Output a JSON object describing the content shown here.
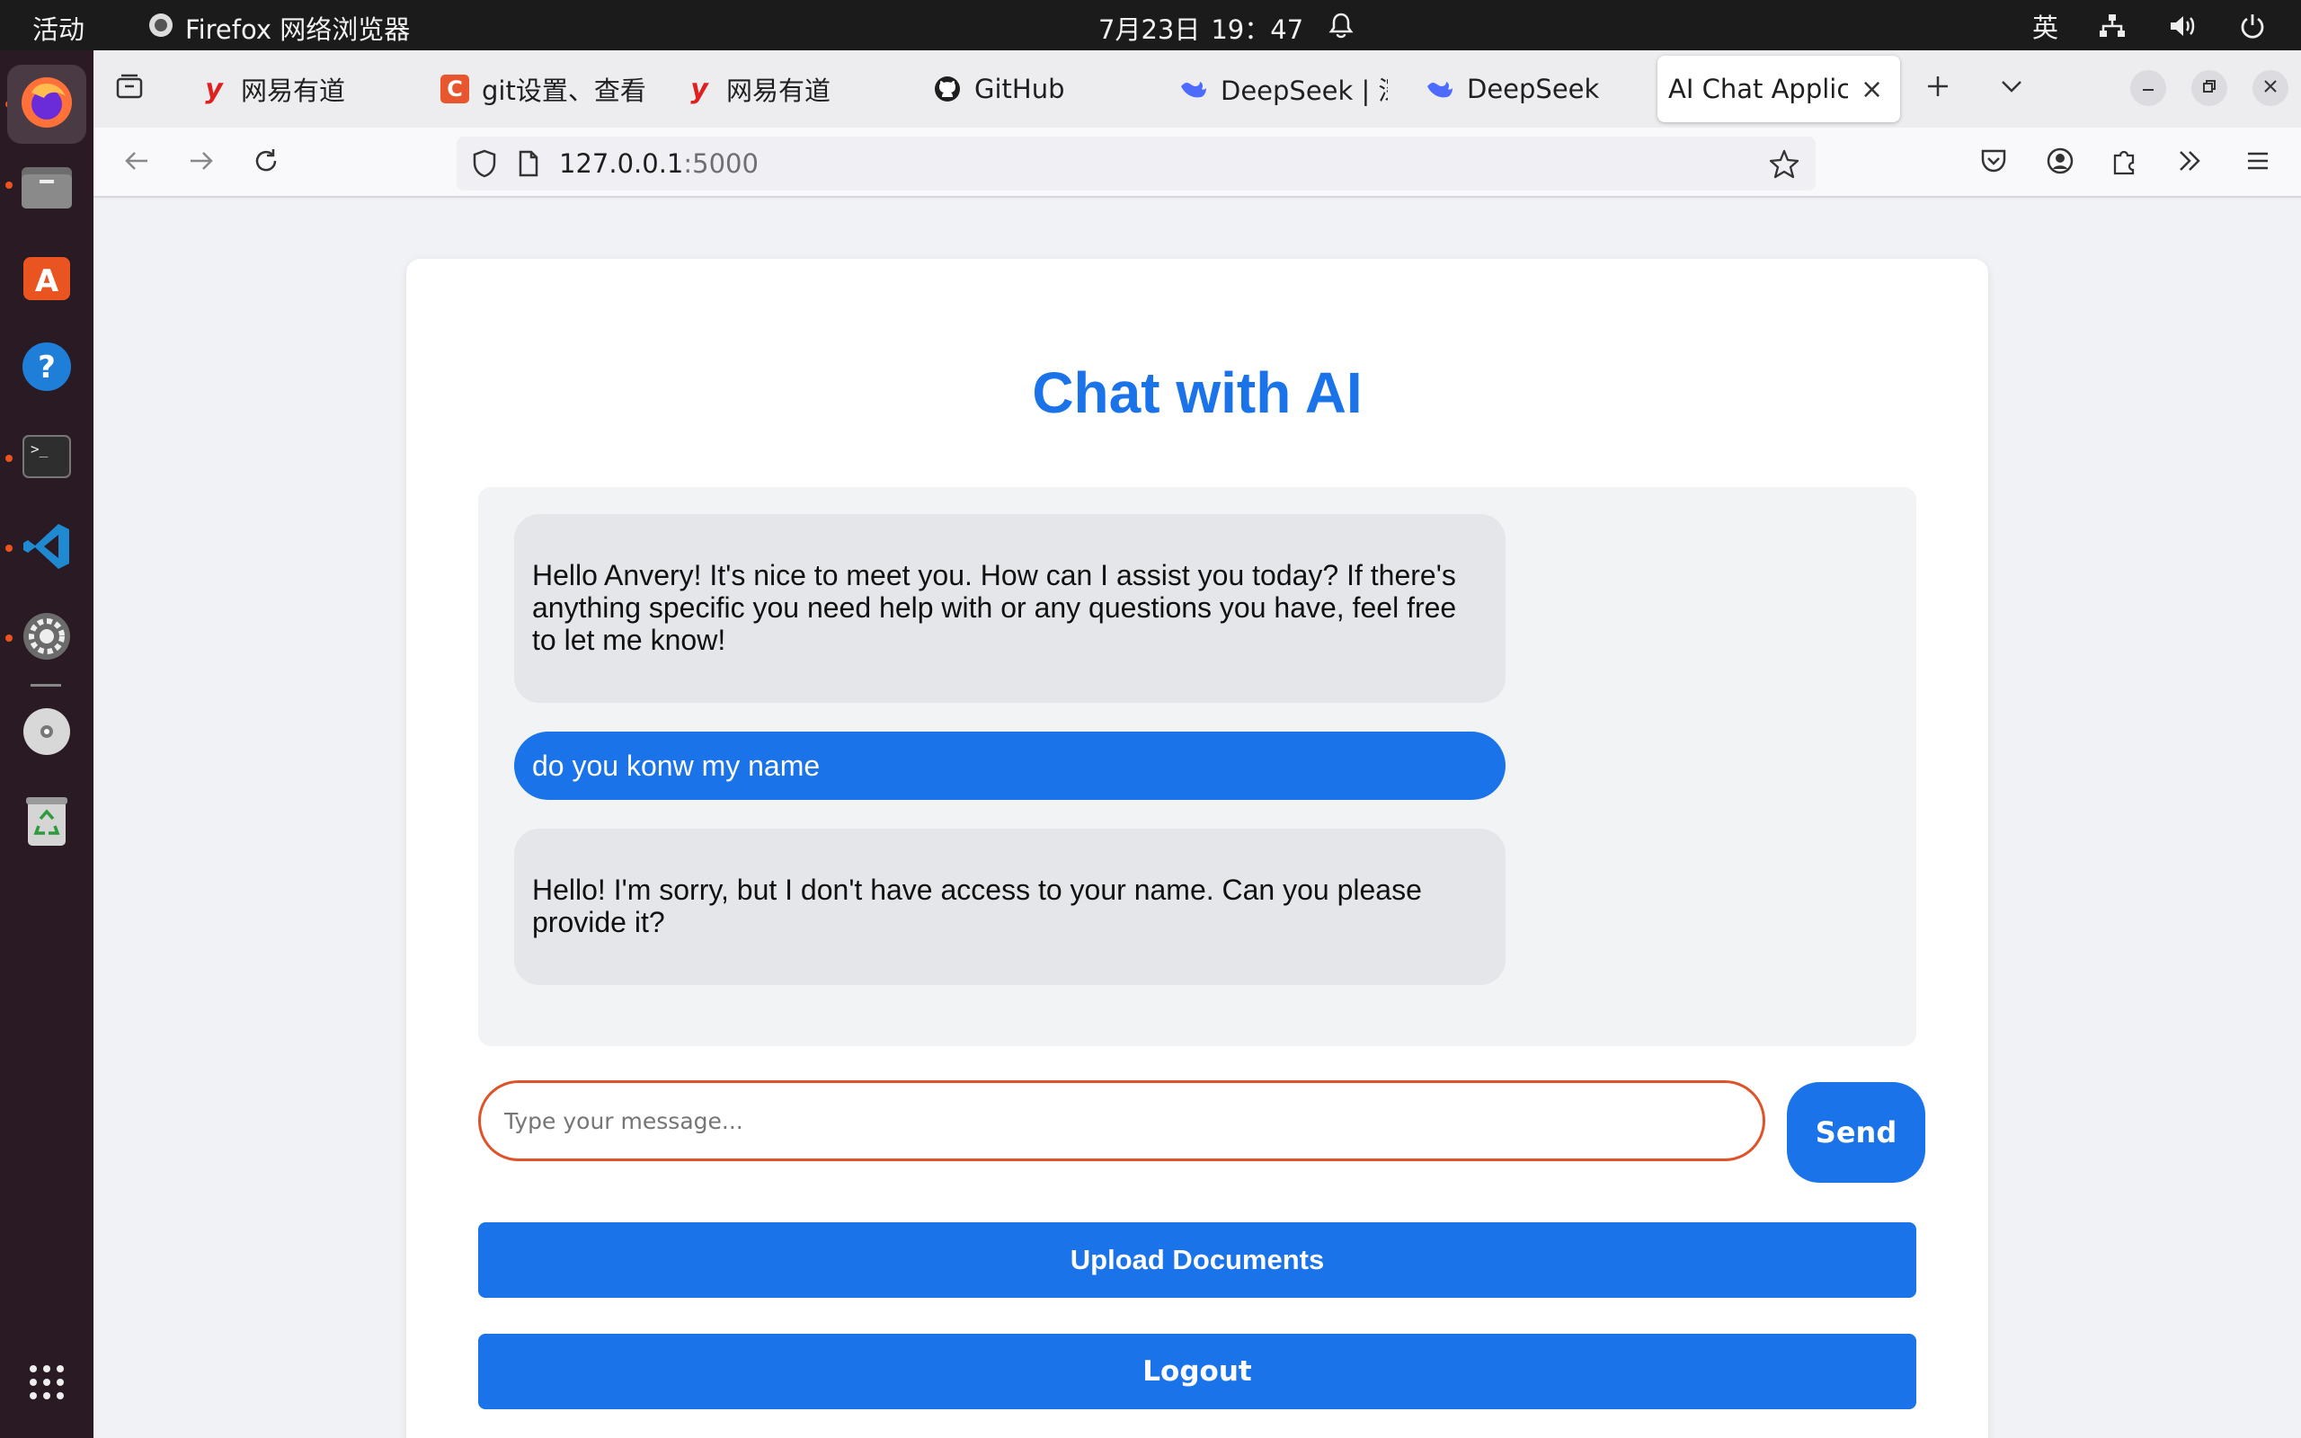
{
  "system": {
    "activities": "活动",
    "app_name": "Firefox 网络浏览器",
    "date": "7月23日",
    "time": "19：47",
    "input_method": "英"
  },
  "tabs": [
    {
      "label": "网易有道",
      "icon": "youdao-icon"
    },
    {
      "label": "git设置、查看",
      "icon": "csdn-icon"
    },
    {
      "label": "网易有道",
      "icon": "youdao-icon"
    },
    {
      "label": "GitHub",
      "icon": "github-icon"
    },
    {
      "label": "DeepSeek | 深",
      "icon": "deepseek-icon"
    },
    {
      "label": "DeepSeek",
      "icon": "deepseek-icon"
    },
    {
      "label": "AI Chat Applica",
      "icon": "",
      "selected": true
    }
  ],
  "url": {
    "host": "127.0.0.1",
    "port": ":5000"
  },
  "page": {
    "title": "Chat with AI",
    "messages": [
      {
        "role": "ai",
        "text": "Hello Anvery! It's nice to meet you. How can I assist you today? If there's anything specific you need help with or any questions you have, feel free to let me know!"
      },
      {
        "role": "user",
        "text": "do you konw my name"
      },
      {
        "role": "ai",
        "text": "Hello! I'm sorry, but I don't have access to your name. Can you please provide it?"
      }
    ],
    "input_placeholder": "Type your message...",
    "input_value": "",
    "send_label": "Send",
    "upload_label": "Upload Documents",
    "logout_label": "Logout"
  },
  "colors": {
    "accent": "#1a73e8",
    "input_focus_border": "#e0532a",
    "ai_bubble": "#e4e6ea",
    "chat_bg": "#f2f3f5"
  }
}
